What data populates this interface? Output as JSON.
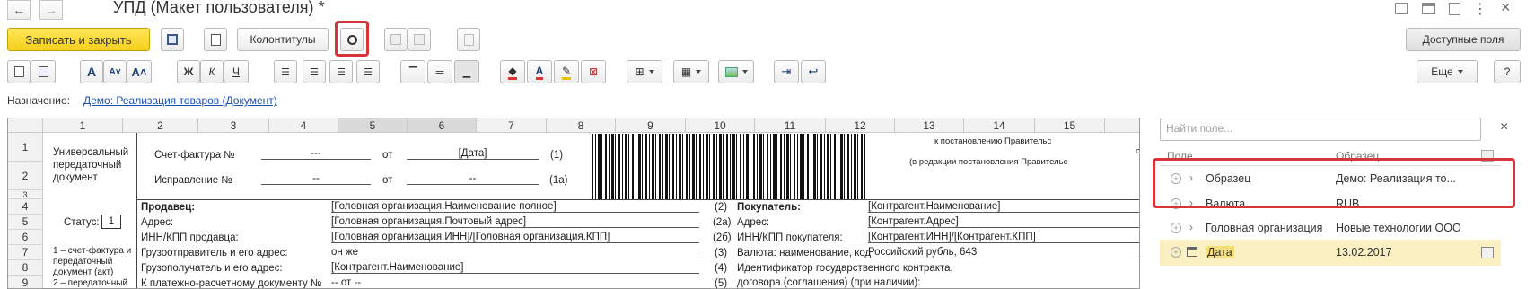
{
  "header": {
    "title": "УПД (Макет пользователя) *",
    "back": "←",
    "forward": "→"
  },
  "toolbar": {
    "save_close": "Записать и закрыть",
    "headers_footers": "Колонтитулы",
    "available_fields": "Доступные поля",
    "more": "Еще",
    "help": "?"
  },
  "purpose": {
    "label": "Назначение:",
    "link": "Демо: Реализация товаров (Документ)"
  },
  "sheet": {
    "columns": [
      "1",
      "2",
      "3",
      "4",
      "5",
      "6",
      "7",
      "8",
      "9",
      "10",
      "11",
      "12",
      "13",
      "14",
      "15"
    ],
    "rows": [
      "1",
      "2",
      "3",
      "4",
      "5",
      "6",
      "7",
      "8",
      "9"
    ],
    "doc_title": [
      "Универсальный",
      "передаточный",
      "документ"
    ],
    "status_label": "Статус:",
    "status_value": "1",
    "status_note": [
      "1 – счет-фактура и",
      "передаточный",
      "документ (акт)",
      "2 – передаточный"
    ],
    "invoice_label": "Счет-фактура №",
    "invoice_num": "---",
    "from1": "от",
    "date": "[Дата]",
    "code1": "(1)",
    "correction_label": "Исправление №",
    "correction_num": "--",
    "from2": "от",
    "correction_date": "--",
    "code1a": "(1а)",
    "decree1": "к постановлению Правительс",
    "decree_o": "о",
    "decree2": "(в редакции постановления Правительс",
    "seller_label": "Продавец:",
    "seller_value": "[Головная организация.Наименование полное]",
    "code2": "(2)",
    "address_label": "Адрес:",
    "address_value": "[Головная организация.Почтовый адрес]",
    "code2a": "(2а)",
    "inn_label": "ИНН/КПП продавца:",
    "inn_value": "[Головная организация.ИНН]/[Головная организация.КПП]",
    "code2b": "(2б)",
    "shipper_label": "Грузоотправитель и его адрес:",
    "shipper_value": "он же",
    "code3": "(3)",
    "consignee_label": "Грузополучатель и его адрес:",
    "consignee_value": "[Контрагент.Наименование]",
    "code4": "(4)",
    "payment_label": "К платежно-расчетному документу №",
    "payment_value": "-- от --",
    "code5": "(5)",
    "buyer_label": "Покупатель:",
    "buyer_value": "[Контрагент.Наименование]",
    "buyer_address_label": "Адрес:",
    "buyer_address_value": "[Контрагент.Адрес]",
    "buyer_inn_label": "ИНН/КПП покупателя:",
    "buyer_inn_value": "[Контрагент.ИНН]/[Контрагент.КПП]",
    "currency_label": "Валюта: наименование, код",
    "currency_value": "Российский рубль, 643",
    "contract_label1": "Идентификатор государственного контракта,",
    "contract_label2": "договора (соглашения) (при наличии):"
  },
  "panel": {
    "search_placeholder": "Найти поле...",
    "clear": "×",
    "col_field": "Поле",
    "col_sample": "Образец",
    "rows": [
      {
        "name": "Образец",
        "value": "Демо: Реализация то..."
      },
      {
        "name": "Валюта",
        "value": "RUB"
      },
      {
        "name": "Головная организация",
        "value": "Новые технологии ООО"
      },
      {
        "name": "Дата",
        "value": "13.02.2017"
      }
    ]
  },
  "colors": {
    "accent_yellow": "#f5cf1c",
    "highlight_red": "#d9343a",
    "link_blue": "#1a4fb4",
    "selected_row": "#fbf0c2"
  }
}
